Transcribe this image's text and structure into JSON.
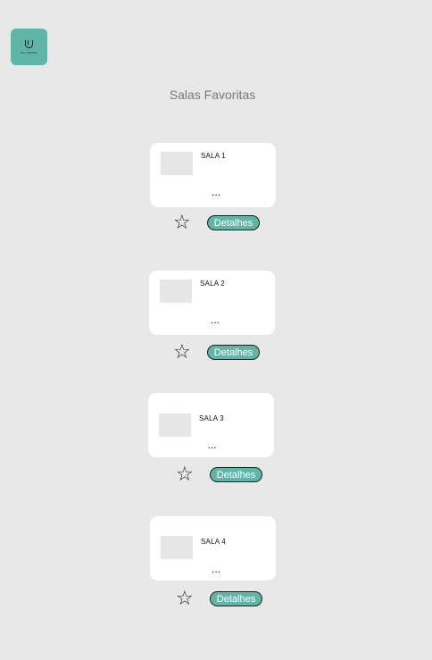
{
  "app": {
    "logo_text": "MY OFFICE"
  },
  "page": {
    "title": "Salas Favoritas"
  },
  "rooms": [
    {
      "name": "SALA 1",
      "description": "...",
      "details_label": "Detalhes",
      "favorite_icon": "star-outline-icon"
    },
    {
      "name": "SALA 2",
      "description": "...",
      "details_label": "Detalhes",
      "favorite_icon": "star-outline-icon"
    },
    {
      "name": "SALA 3",
      "description": "...",
      "details_label": "Detalhes",
      "favorite_icon": "star-outline-icon"
    },
    {
      "name": "SALA 4",
      "description": "...",
      "details_label": "Detalhes",
      "favorite_icon": "star-outline-icon"
    }
  ],
  "colors": {
    "background": "#e8e8e8",
    "accent": "#5fb6a8",
    "card": "#ffffff",
    "thumbnail_placeholder": "#e6e6e6",
    "title_text": "#7a7a7a"
  }
}
